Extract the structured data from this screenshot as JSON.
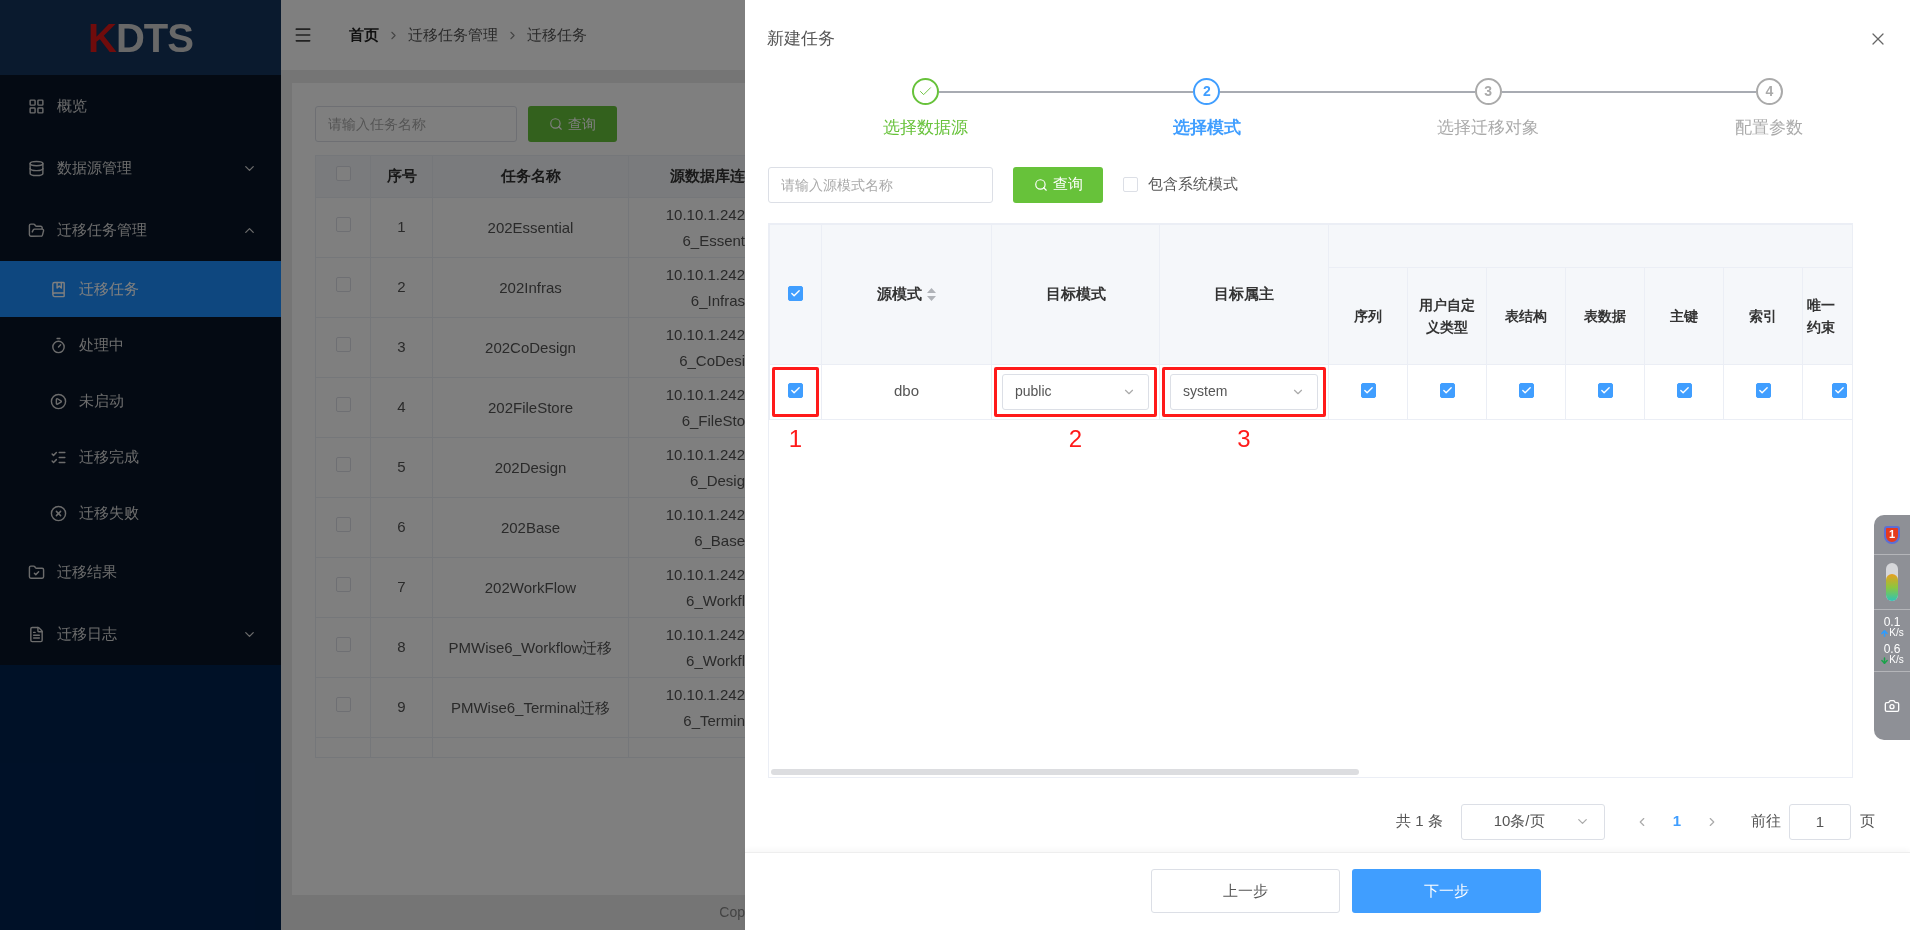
{
  "sidebar": {
    "logo": {
      "accent": "K",
      "text": "DTS"
    },
    "items": [
      {
        "label": "概览",
        "selected": false
      },
      {
        "label": "数据源管理",
        "selected": false,
        "expanded": false
      },
      {
        "label": "迁移任务管理",
        "selected": false,
        "expanded": true,
        "children": [
          {
            "label": "迁移任务",
            "selected": true
          },
          {
            "label": "处理中",
            "selected": false
          },
          {
            "label": "未启动",
            "selected": false
          },
          {
            "label": "迁移完成",
            "selected": false
          },
          {
            "label": "迁移失败",
            "selected": false
          }
        ]
      },
      {
        "label": "迁移结果",
        "selected": false
      },
      {
        "label": "迁移日志",
        "selected": false,
        "expanded": false
      }
    ]
  },
  "breadcrumb": [
    "首页",
    "迁移任务管理",
    "迁移任务"
  ],
  "task_list": {
    "header_checked": false,
    "search": {
      "placeholder": "请输入任务名称"
    },
    "search_button": "查询",
    "columns": [
      "序号",
      "任务名称",
      "源数据库连"
    ],
    "rows": [
      {
        "checked": false,
        "no": "1",
        "name": "202Essential",
        "source": [
          "10.10.1.242",
          "6_Essent"
        ]
      },
      {
        "checked": false,
        "no": "2",
        "name": "202Infras",
        "source": [
          "10.10.1.242",
          "6_Infras"
        ]
      },
      {
        "checked": false,
        "no": "3",
        "name": "202CoDesign",
        "source": [
          "10.10.1.242",
          "6_CoDesi"
        ]
      },
      {
        "checked": false,
        "no": "4",
        "name": "202FileStore",
        "source": [
          "10.10.1.242",
          "6_FileSto"
        ]
      },
      {
        "checked": false,
        "no": "5",
        "name": "202Design",
        "source": [
          "10.10.1.242",
          "6_Desig"
        ]
      },
      {
        "checked": false,
        "no": "6",
        "name": "202Base",
        "source": [
          "10.10.1.242",
          "6_Base"
        ]
      },
      {
        "checked": false,
        "no": "7",
        "name": "202WorkFlow",
        "source": [
          "10.10.1.242",
          "6_Workfl"
        ]
      },
      {
        "checked": false,
        "no": "8",
        "name": "PMWise6_Workflow迁移",
        "source": [
          "10.10.1.242",
          "6_Workfl"
        ]
      },
      {
        "checked": false,
        "no": "9",
        "name": "PMWise6_Terminal迁移",
        "source": [
          "10.10.1.242",
          "6_Termin"
        ]
      }
    ],
    "footer": "Cop"
  },
  "drawer": {
    "title": "新建任务",
    "steps": [
      {
        "label": "选择数据源",
        "done": true,
        "selected": false
      },
      {
        "number": "2",
        "label": "选择模式",
        "done": false,
        "selected": true
      },
      {
        "number": "3",
        "label": "选择迁移对象",
        "done": false,
        "selected": false
      },
      {
        "number": "4",
        "label": "配置参数",
        "done": false,
        "selected": false
      }
    ],
    "filter": {
      "placeholder": "请输入源模式名称",
      "button": "查询",
      "system_schemas": {
        "label": "包含系统模式",
        "checked": false
      }
    },
    "table": {
      "header_checked": true,
      "source_column": "源模式",
      "target_schema_column": "目标模式",
      "target_owner_column": "目标属主",
      "object_columns": [
        "序列",
        "用户自定义类型",
        "表结构",
        "表数据",
        "主键",
        "索引"
      ],
      "last_column_lines": [
        "唯一",
        "约束"
      ],
      "rows": [
        {
          "selected": true,
          "source": "dbo",
          "target_schema": "public",
          "target_owner": "system",
          "objects": [
            true,
            true,
            true,
            true,
            true,
            true,
            true
          ]
        }
      ]
    },
    "annotations": [
      {
        "label": "1"
      },
      {
        "label": "2"
      },
      {
        "label": "3"
      }
    ],
    "pagination": {
      "total": "共 1 条",
      "page_size": "10条/页",
      "pages": [
        {
          "label": "1",
          "selected": true
        }
      ],
      "goto_label": "前往",
      "goto_value": "1",
      "goto_unit": "页"
    },
    "buttons": {
      "prev": "上一步",
      "next": "下一步"
    }
  },
  "speed_widget": {
    "badge": "1",
    "upload": "0.1",
    "upload_unit": "K/s",
    "download": "0.6",
    "download_unit": "K/s"
  }
}
